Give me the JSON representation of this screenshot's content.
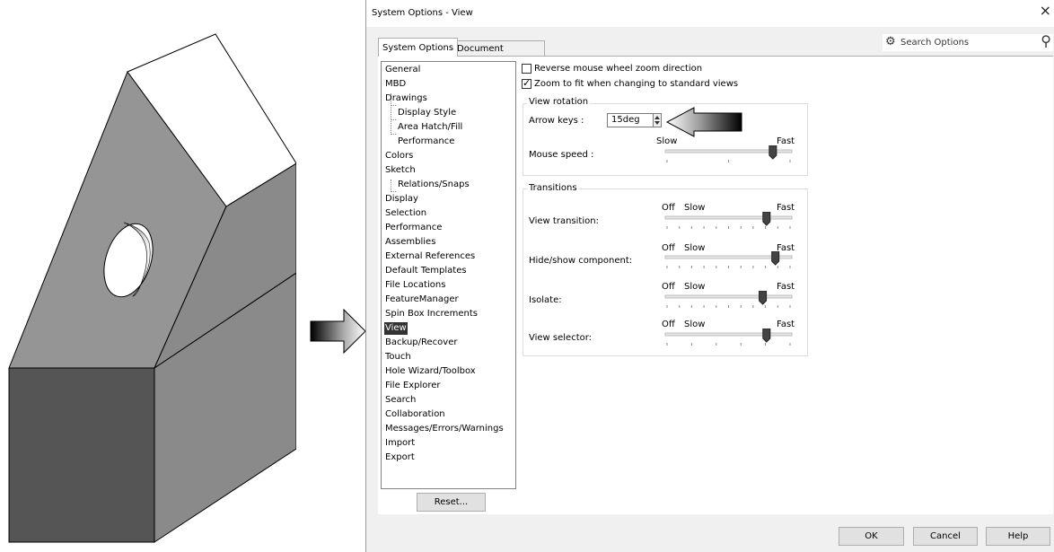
{
  "dialog": {
    "title": "System Options - View",
    "close_glyph": "×",
    "tabs": [
      {
        "label": "System Options",
        "mnemonic": "S",
        "active": true
      },
      {
        "label": "Document Properties",
        "mnemonic": "D",
        "active": false
      }
    ],
    "search": {
      "placeholder": "Search Options",
      "icon": "gear-icon",
      "search_icon": "magnifier-icon"
    }
  },
  "tree": {
    "items": [
      {
        "label": "General",
        "level": 0
      },
      {
        "label": "MBD",
        "level": 0
      },
      {
        "label": "Drawings",
        "level": 0
      },
      {
        "label": "Display Style",
        "level": 1
      },
      {
        "label": "Area Hatch/Fill",
        "level": 1
      },
      {
        "label": "Performance",
        "level": 1
      },
      {
        "label": "Colors",
        "level": 0
      },
      {
        "label": "Sketch",
        "level": 0
      },
      {
        "label": "Relations/Snaps",
        "level": 1
      },
      {
        "label": "Display",
        "level": 0
      },
      {
        "label": "Selection",
        "level": 0
      },
      {
        "label": "Performance",
        "level": 0
      },
      {
        "label": "Assemblies",
        "level": 0
      },
      {
        "label": "External References",
        "level": 0
      },
      {
        "label": "Default Templates",
        "level": 0
      },
      {
        "label": "File Locations",
        "level": 0
      },
      {
        "label": "FeatureManager",
        "level": 0
      },
      {
        "label": "Spin Box Increments",
        "level": 0
      },
      {
        "label": "View",
        "level": 0,
        "selected": true
      },
      {
        "label": "Backup/Recover",
        "level": 0
      },
      {
        "label": "Touch",
        "level": 0
      },
      {
        "label": "Hole Wizard/Toolbox",
        "level": 0
      },
      {
        "label": "File Explorer",
        "level": 0
      },
      {
        "label": "Search",
        "level": 0
      },
      {
        "label": "Collaboration",
        "level": 0
      },
      {
        "label": "Messages/Errors/Warnings",
        "level": 0
      },
      {
        "label": "Import",
        "level": 0
      },
      {
        "label": "Export",
        "level": 0
      }
    ],
    "reset_label": "Reset..."
  },
  "options": {
    "reverse_zoom": {
      "label": "Reverse mouse wheel zoom direction",
      "checked": false
    },
    "zoom_to_fit": {
      "label": "Zoom to fit when changing to standard views",
      "checked": true
    },
    "view_rotation": {
      "group_label": "View rotation",
      "arrow_keys_label": "Arrow keys :",
      "arrow_keys_value": "15deg",
      "mouse_speed_label": "Mouse speed :",
      "slow_label": "Slow",
      "fast_label": "Fast",
      "mouse_speed_level": 0.85
    },
    "transitions": {
      "group_label": "Transitions",
      "sliders": [
        {
          "label": "View transition:",
          "off": "Off",
          "slow": "Slow",
          "fast": "Fast",
          "level": 0.8
        },
        {
          "label": "Hide/show component:",
          "off": "Off",
          "slow": "Slow",
          "fast": "Fast",
          "level": 0.87
        },
        {
          "label": "Isolate:",
          "off": "Off",
          "slow": "Slow",
          "fast": "Fast",
          "level": 0.77
        },
        {
          "label": "View selector:",
          "off": "Off",
          "slow": "Slow",
          "fast": "Fast",
          "level": 0.8
        }
      ]
    }
  },
  "footer": {
    "ok_label": "OK",
    "cancel_label": "Cancel",
    "help_label": "Help"
  },
  "colors": {
    "selected_bg": "#333333",
    "dialog_bg": "#f0f0f0",
    "part_face_dark": "#555555",
    "part_face_mid": "#8f8f8f"
  }
}
